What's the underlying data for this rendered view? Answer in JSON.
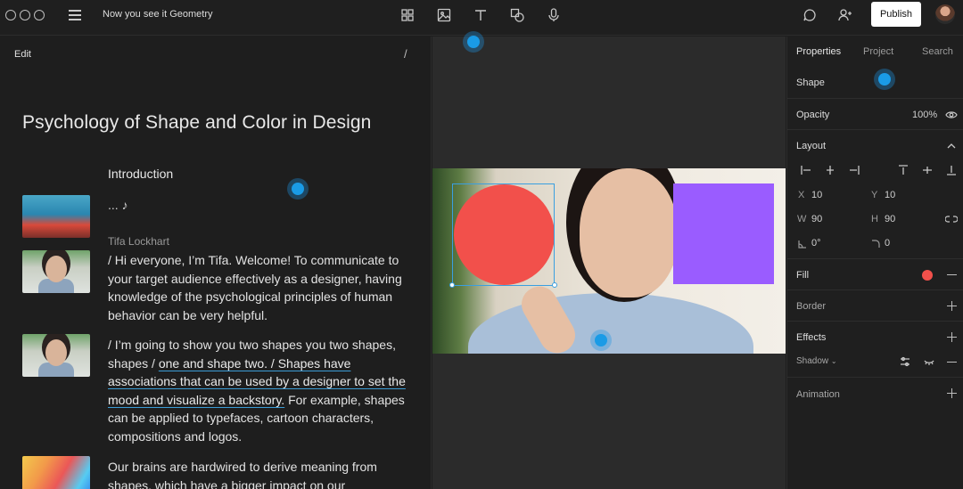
{
  "header": {
    "document_title": "Now you see it Geometry",
    "publish_label": "Publish",
    "window_controls": [
      "circle-icon",
      "circle-icon",
      "circle-icon"
    ],
    "tools": [
      "grid-icon",
      "image-icon",
      "text-icon",
      "shapes-icon",
      "microphone-icon"
    ],
    "right_icons": [
      "comment-icon",
      "add-user-icon",
      "avatar"
    ]
  },
  "editor": {
    "edit_label": "Edit",
    "slash": "/",
    "heading": "Psychology of Shape and Color in Design",
    "section_title": "Introduction",
    "music_line": "... ♪",
    "speaker": "Tifa Lockhart",
    "paragraphs": {
      "p1": "/ Hi everyone, I’m Tifa. Welcome! To communicate to your target audience effectively as a designer, having knowledge of the psychological principles of human behavior can be very helpful.",
      "p2_before": "/ I’m going to show you two shapes you two shapes, shapes / ",
      "p2_highlight": "one and shape two. / Shapes have associations that can be used by a designer to set the mood and visualize a backstory.",
      "p2_after": " For example, shapes can be applied to typefaces, cartoon characters, compositions and logos.",
      "p3": "Our brains are hardwired to derive meaning from shapes, which have a bigger impact on our"
    }
  },
  "canvas": {
    "shapes": [
      {
        "name": "circle",
        "color": "#f2504b"
      },
      {
        "name": "square",
        "color": "#9a5cff"
      }
    ],
    "selection_color": "#3a9fe0"
  },
  "properties": {
    "tabs": [
      "Properties",
      "Project",
      "Search"
    ],
    "shape_label": "Shape",
    "opacity_label": "Opacity",
    "opacity_value": "100%",
    "layout_label": "Layout",
    "x_label": "X",
    "x_value": "10",
    "y_label": "Y",
    "y_value": "10",
    "w_label": "W",
    "w_value": "90",
    "h_label": "H",
    "h_value": "90",
    "rotation_value": "0°",
    "radius_value": "0",
    "fill_label": "Fill",
    "fill_color": "#f2504b",
    "border_label": "Border",
    "effects_label": "Effects",
    "shadow_label": "Shadow",
    "animation_label": "Animation"
  },
  "colors": {
    "accent": "#1a9be6",
    "background": "#1e1e1e",
    "panel": "#1f1f1f",
    "canvas": "#2b2b2b"
  }
}
